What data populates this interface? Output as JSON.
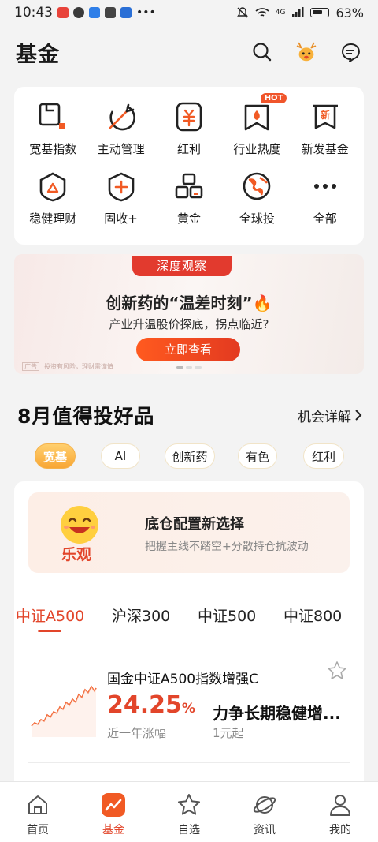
{
  "status_bar": {
    "time": "10:43",
    "battery": "63%",
    "network": "4G"
  },
  "header": {
    "title": "基金"
  },
  "quick_entries": [
    {
      "label": "宽基指数",
      "icon": "broad-index-icon"
    },
    {
      "label": "主动管理",
      "icon": "target-arrow-icon"
    },
    {
      "label": "红利",
      "icon": "dividend-icon"
    },
    {
      "label": "行业热度",
      "icon": "fire-flag-icon",
      "badge": "HOT"
    },
    {
      "label": "新发基金",
      "icon": "new-fund-icon"
    },
    {
      "label": "稳健理财",
      "icon": "shield-tent-icon"
    },
    {
      "label": "固收+",
      "icon": "plus-shield-icon"
    },
    {
      "label": "黄金",
      "icon": "gold-bars-icon"
    },
    {
      "label": "全球投",
      "icon": "globe-icon"
    },
    {
      "label": "全部",
      "icon": "more-dots-icon"
    }
  ],
  "banner": {
    "tag": "深度观察",
    "title": "创新药的“温差时刻”",
    "subtitle": "产业升温股价探底，拐点临近?",
    "button": "立即查看",
    "ad_label": "广告",
    "disclaimer": "投资有风险，理财需谨慎"
  },
  "section": {
    "title": "8月值得投好品",
    "link": "机会详解"
  },
  "chips": [
    "宽基",
    "AI",
    "创新药",
    "有色",
    "红利"
  ],
  "active_chip": "宽基",
  "promo": {
    "mood": "乐观",
    "title": "底仓配置新选择",
    "subtitle": "把握主线不踏空+分散持仓抗波动"
  },
  "index_tabs": [
    "中证A500",
    "沪深300",
    "中证500",
    "中证800"
  ],
  "active_index_tab": "中证A500",
  "fund": {
    "name": "国金中证A500指数增强C",
    "rate": "24.25",
    "rate_unit": "%",
    "rate_label": "近一年涨幅",
    "slogan": "力争长期稳健增...",
    "min_invest": "1元起"
  },
  "bottom_nav": [
    {
      "label": "首页",
      "icon": "home-icon"
    },
    {
      "label": "基金",
      "icon": "fund-chart-icon",
      "active": true
    },
    {
      "label": "自选",
      "icon": "star-icon"
    },
    {
      "label": "资讯",
      "icon": "planet-icon"
    },
    {
      "label": "我的",
      "icon": "user-icon"
    }
  ],
  "colors": {
    "accent": "#e2452a",
    "chip_active": "#f8a634",
    "banner_tag": "#e23a2e"
  }
}
